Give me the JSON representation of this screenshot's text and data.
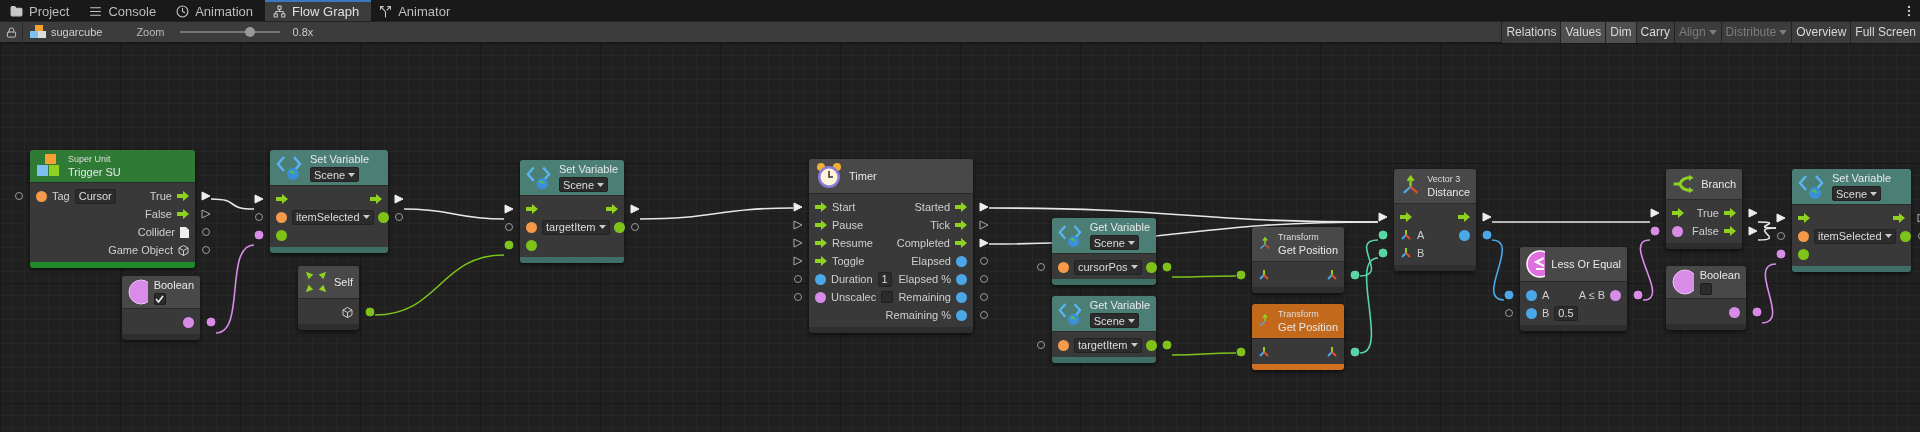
{
  "tabs": [
    {
      "label": "Project",
      "kind": "folder",
      "selected": false
    },
    {
      "label": "Console",
      "kind": "console",
      "selected": false
    },
    {
      "label": "Animation",
      "kind": "clock",
      "selected": false
    },
    {
      "label": "Flow Graph",
      "kind": "graph",
      "selected": true
    },
    {
      "label": "Animator",
      "kind": "animator",
      "selected": false
    }
  ],
  "toolbar": {
    "graph_name": "sugarcube",
    "zoom_label": "Zoom",
    "zoom": {
      "level": 0.7
    },
    "zoom_reading": "0.8x",
    "buttons": [
      {
        "label": "Relations",
        "pressed": false,
        "disabled": false,
        "dropdown": false
      },
      {
        "label": "Values",
        "pressed": true,
        "disabled": false,
        "dropdown": false
      },
      {
        "label": "Dim",
        "pressed": true,
        "disabled": false,
        "dropdown": false
      },
      {
        "label": "Carry",
        "pressed": false,
        "disabled": false,
        "dropdown": false
      },
      {
        "label": "Align",
        "pressed": false,
        "disabled": true,
        "dropdown": true
      },
      {
        "label": "Distribute",
        "pressed": false,
        "disabled": true,
        "dropdown": true
      },
      {
        "label": "Overview",
        "pressed": false,
        "disabled": false,
        "dropdown": false
      },
      {
        "label": "Full Screen",
        "pressed": false,
        "disabled": false,
        "dropdown": false
      }
    ]
  },
  "nodes": [
    {
      "kind": "super_unit",
      "selected": false,
      "subtitle": "Super Unit",
      "title": "Trigger SU",
      "rows": [
        {
          "in": {
            "kind": "dot",
            "color": "#f59a4a",
            "connected": false
          },
          "label": "Tag",
          "field": {
            "kind": "text",
            "value": "Cursor"
          },
          "out_label": "True",
          "out": {
            "kind": "flow",
            "connected": true
          }
        },
        {
          "out_label": "False",
          "out": {
            "kind": "flow",
            "connected": false
          }
        },
        {
          "out_label": "Collider",
          "out": {
            "kind": "document",
            "connected": false
          }
        },
        {
          "out_label": "Game Object",
          "out": {
            "kind": "cube",
            "connected": false
          }
        }
      ]
    },
    {
      "kind": "set_variable",
      "selected": false,
      "title": "Set Variable",
      "scope": "Scene",
      "rows": [
        {
          "in": {
            "kind": "flow",
            "connected": true
          },
          "out": {
            "kind": "flow",
            "connected": true
          }
        },
        {
          "in": {
            "kind": "dot",
            "color": "#f59a4a",
            "connected": false
          },
          "field": {
            "kind": "dropdown",
            "value": "itemSelected"
          },
          "out": {
            "kind": "dot",
            "color": "#7fc31a",
            "connected": false
          }
        },
        {
          "in": {
            "kind": "dot",
            "color": "#7fc31a",
            "connected": true
          }
        }
      ]
    },
    {
      "kind": "set_variable",
      "selected": false,
      "title": "Set Variable",
      "scope": "Scene",
      "rows": [
        {
          "in": {
            "kind": "flow",
            "connected": true
          },
          "out": {
            "kind": "flow",
            "connected": true
          }
        },
        {
          "in": {
            "kind": "dot",
            "color": "#f59a4a",
            "connected": false
          },
          "field": {
            "kind": "dropdown",
            "value": "targetItem"
          },
          "out": {
            "kind": "dot",
            "color": "#7fc31a",
            "connected": false
          }
        },
        {
          "in": {
            "kind": "dot",
            "color": "#7fc31a",
            "connected": true
          }
        }
      ]
    },
    {
      "kind": "boolean",
      "selected": false,
      "title": "Boolean",
      "value": {
        "checked": true
      },
      "rows": [
        {
          "out": {
            "kind": "dot",
            "color": "#d88ce8",
            "connected": true
          }
        }
      ]
    },
    {
      "kind": "self",
      "selected": false,
      "title": "Self",
      "rows": [
        {
          "out": {
            "kind": "cube",
            "connected": true
          }
        }
      ]
    },
    {
      "kind": "timer",
      "selected": false,
      "title": "Timer",
      "rows": [
        {
          "in": {
            "kind": "flow",
            "connected": true
          },
          "label": "Start",
          "out_label": "Started",
          "out": {
            "kind": "flow",
            "connected": true
          }
        },
        {
          "in": {
            "kind": "flow",
            "connected": false
          },
          "label": "Pause",
          "out_label": "Tick",
          "out": {
            "kind": "flow",
            "connected": false
          }
        },
        {
          "in": {
            "kind": "flow",
            "connected": false
          },
          "label": "Resume",
          "out_label": "Completed",
          "out": {
            "kind": "flow",
            "connected": true
          }
        },
        {
          "in": {
            "kind": "flow",
            "connected": false
          },
          "label": "Toggle",
          "out_label": "Elapsed",
          "out": {
            "kind": "dot",
            "color": "#4aa8e8",
            "connected": false
          }
        },
        {
          "in": {
            "kind": "dot",
            "color": "#4aa8e8",
            "connected": false
          },
          "label": "Duration",
          "field": {
            "kind": "text",
            "value": "1"
          },
          "out_label": "Elapsed %",
          "out": {
            "kind": "dot",
            "color": "#4aa8e8",
            "connected": false
          }
        },
        {
          "in": {
            "kind": "dot",
            "color": "#d88ce8",
            "connected": false
          },
          "label": "Unscalec",
          "field": {
            "kind": "checkbox",
            "checked": false
          },
          "out_label": "Remaining",
          "out": {
            "kind": "dot",
            "color": "#4aa8e8",
            "connected": false
          }
        },
        {
          "out_label": "Remaining %",
          "out": {
            "kind": "dot",
            "color": "#4aa8e8",
            "connected": false
          }
        }
      ]
    },
    {
      "kind": "get_variable",
      "selected": false,
      "title": "Get Variable",
      "scope": "Scene",
      "rows": [
        {
          "in": {
            "kind": "dot",
            "color": "#f59a4a",
            "connected": false
          },
          "field": {
            "kind": "dropdown",
            "value": "cursorPos"
          },
          "out": {
            "kind": "dot",
            "color": "#7fc31a",
            "connected": true
          }
        }
      ]
    },
    {
      "kind": "get_variable",
      "selected": false,
      "title": "Get Variable",
      "scope": "Scene",
      "rows": [
        {
          "in": {
            "kind": "dot",
            "color": "#f59a4a",
            "connected": false
          },
          "field": {
            "kind": "dropdown",
            "value": "targetItem"
          },
          "out": {
            "kind": "dot",
            "color": "#7fc31a",
            "connected": true
          }
        }
      ]
    },
    {
      "kind": "transform",
      "selected": false,
      "subtitle": "Transform",
      "title": "Get Position",
      "rows": [
        {
          "in": {
            "kind": "vector",
            "connected": true
          },
          "out": {
            "kind": "vector",
            "connected": true
          }
        }
      ]
    },
    {
      "kind": "transform",
      "selected": true,
      "subtitle": "Transform",
      "title": "Get Position",
      "rows": [
        {
          "in": {
            "kind": "vector",
            "connected": true
          },
          "out": {
            "kind": "vector",
            "connected": true
          }
        }
      ]
    },
    {
      "kind": "vector3",
      "selected": false,
      "subtitle": "Vector 3",
      "title": "Distance",
      "rows": [
        {
          "in": {
            "kind": "flow",
            "connected": true
          },
          "out": {
            "kind": "flow",
            "connected": true
          }
        },
        {
          "in": {
            "kind": "vector",
            "connected": true
          },
          "label": "A",
          "out": {
            "kind": "dot",
            "color": "#4aa8e8",
            "connected": true
          }
        },
        {
          "in": {
            "kind": "vector",
            "connected": true
          },
          "label": "B"
        }
      ]
    },
    {
      "kind": "compare",
      "selected": false,
      "title": "Less Or Equal",
      "rows": [
        {
          "in": {
            "kind": "dot",
            "color": "#4aa8e8",
            "connected": true
          },
          "label": "A",
          "out_label": "A ≤ B",
          "out": {
            "kind": "dot",
            "color": "#d88ce8",
            "connected": true
          }
        },
        {
          "in": {
            "kind": "dot",
            "color": "#4aa8e8",
            "connected": false
          },
          "label": "B",
          "field": {
            "kind": "text",
            "value": "0.5"
          }
        }
      ]
    },
    {
      "kind": "branch",
      "selected": false,
      "title": "Branch",
      "rows": [
        {
          "in": {
            "kind": "flow",
            "connected": true
          },
          "out_label": "True",
          "out": {
            "kind": "flow",
            "connected": true
          }
        },
        {
          "in": {
            "kind": "dot",
            "color": "#d88ce8",
            "connected": true
          },
          "out_label": "False",
          "out": {
            "kind": "flow",
            "connected": true
          }
        }
      ]
    },
    {
      "kind": "boolean",
      "selected": false,
      "title": "Boolean",
      "value": {
        "checked": false
      },
      "rows": [
        {
          "out": {
            "kind": "dot",
            "color": "#d88ce8",
            "connected": true
          }
        }
      ]
    },
    {
      "kind": "set_variable",
      "selected": false,
      "title": "Set Variable",
      "scope": "Scene",
      "rows": [
        {
          "in": {
            "kind": "flow",
            "connected": true
          },
          "out": {
            "kind": "flow",
            "connected": false
          }
        },
        {
          "in": {
            "kind": "dot",
            "color": "#f59a4a",
            "connected": false
          },
          "field": {
            "kind": "dropdown",
            "value": "itemSelected"
          },
          "out": {
            "kind": "dot",
            "color": "#7fc31a",
            "connected": false
          }
        },
        {
          "in": {
            "kind": "dot",
            "color": "#7fc31a",
            "connected": true
          }
        }
      ]
    }
  ]
}
